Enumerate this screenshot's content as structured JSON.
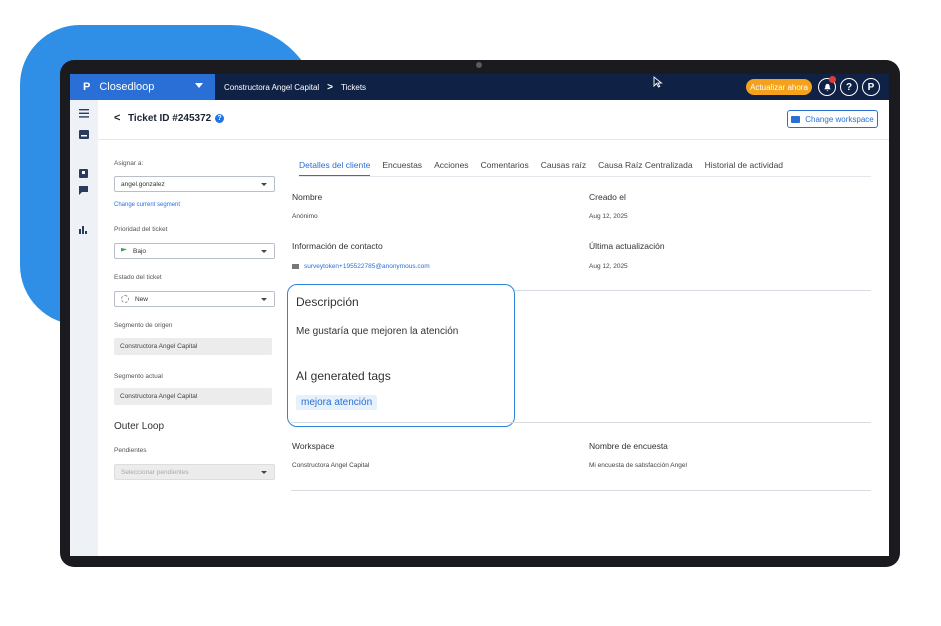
{
  "topbar": {
    "org_name": "Closedloop",
    "logo_letter": "P",
    "breadcrumb": [
      "Constructora Angel Capital",
      "Tickets"
    ],
    "breadcrumb_separator": ">",
    "upgrade_label": "Actualizar ahora",
    "help_label": "?",
    "brand_letter": "P"
  },
  "header": {
    "back_glyph": "<",
    "title": "Ticket ID #245372",
    "info_glyph": "?",
    "change_workspace_label": "Change workspace"
  },
  "left_form": {
    "assign_label": "Asignar a:",
    "assign_value": "angel.gonzalez",
    "change_segment_link": "Change current segment",
    "priority_label": "Prioridad del ticket",
    "priority_value": "Bajo",
    "status_label": "Estado del ticket",
    "status_value": "New",
    "origin_segment_label": "Segmento de origen",
    "origin_segment_value": "Constructora Angel Capital",
    "current_segment_label": "Segmento actual",
    "current_segment_value": "Constructora Angel Capital",
    "outer_loop_title": "Outer Loop",
    "pending_label": "Pendientes",
    "pending_placeholder": "Seleccionar pendientes"
  },
  "tabs": [
    {
      "label": "Detalles del cliente",
      "active": true
    },
    {
      "label": "Encuestas",
      "active": false
    },
    {
      "label": "Acciones",
      "active": false
    },
    {
      "label": "Comentarios",
      "active": false
    },
    {
      "label": "Causas raíz",
      "active": false
    },
    {
      "label": "Causa Raíz Centralizada",
      "active": false
    },
    {
      "label": "Historial de actividad",
      "active": false
    }
  ],
  "details": {
    "name_label": "Nombre",
    "name_value": "Anónimo",
    "created_label": "Creado el",
    "created_value": "Aug 12, 2025",
    "contact_label": "Información de contacto",
    "contact_value": "surveytoken+195522785@anonymous.com",
    "updated_label": "Última actualización",
    "updated_value": "Aug 12, 2025",
    "description_label": "Descripción",
    "description_value": "Me gustaría que mejoren la atención",
    "ai_tags_label": "AI generated tags",
    "ai_tag": "mejora atención",
    "workspace_label": "Workspace",
    "workspace_value": "Constructora Angel Capital",
    "survey_label": "Nombre de encuesta",
    "survey_value": "Mi encuesta de satisfacción Angel"
  },
  "colors": {
    "accent": "#2a6fd6",
    "navbar": "#0f2245",
    "upgrade": "#f4a11b",
    "backdrop_blob": "#2f8fe6",
    "highlight_border": "#2f86d9"
  },
  "icons": [
    "menu-icon",
    "inbox-icon",
    "ticket-icon",
    "chat-icon",
    "chart-icon",
    "bell-icon",
    "help-icon",
    "brand-logo-icon",
    "folder-icon",
    "flag-icon",
    "loading-icon",
    "envelope-icon",
    "cursor-icon"
  ]
}
